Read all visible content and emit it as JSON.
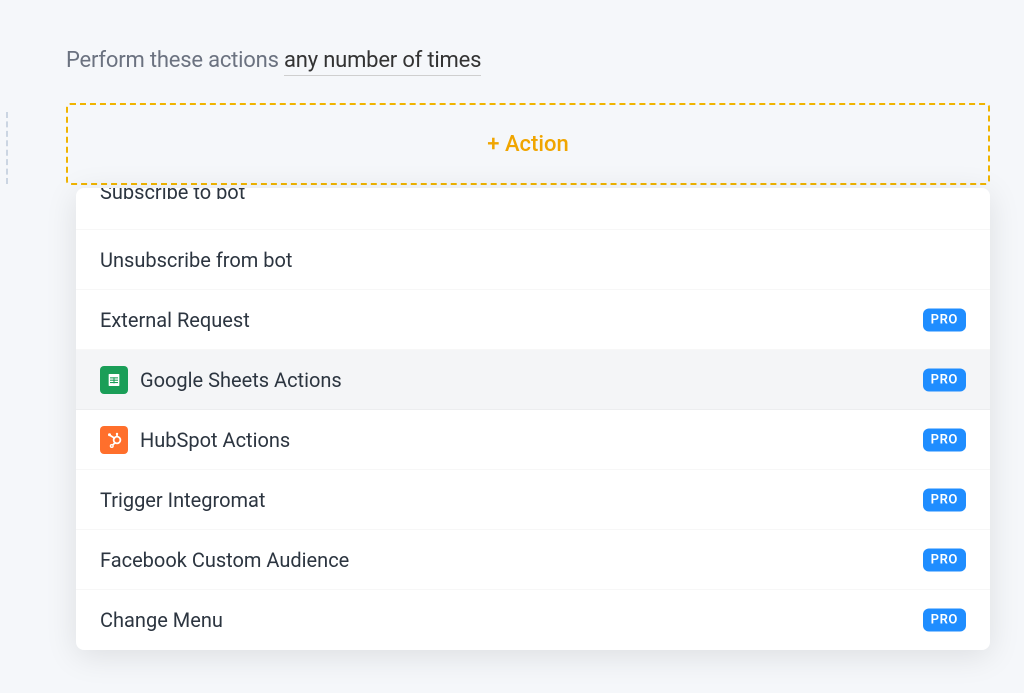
{
  "header": {
    "prefix": "Perform these actions ",
    "link_text": "any number of times"
  },
  "action_button": {
    "label": "+ Action"
  },
  "pro_label": "PRO",
  "items": [
    {
      "label": "Subscribe to bot",
      "pro": false,
      "icon": null,
      "truncated_top": true
    },
    {
      "label": "Unsubscribe from bot",
      "pro": false,
      "icon": null
    },
    {
      "label": "External Request",
      "pro": true,
      "icon": null
    },
    {
      "label": "Google Sheets Actions",
      "pro": true,
      "icon": "sheets",
      "hovered": true
    },
    {
      "label": "HubSpot Actions",
      "pro": true,
      "icon": "hubspot"
    },
    {
      "label": "Trigger Integromat",
      "pro": true,
      "icon": null
    },
    {
      "label": "Facebook Custom Audience",
      "pro": true,
      "icon": null
    },
    {
      "label": "Change Menu",
      "pro": true,
      "icon": null
    }
  ]
}
